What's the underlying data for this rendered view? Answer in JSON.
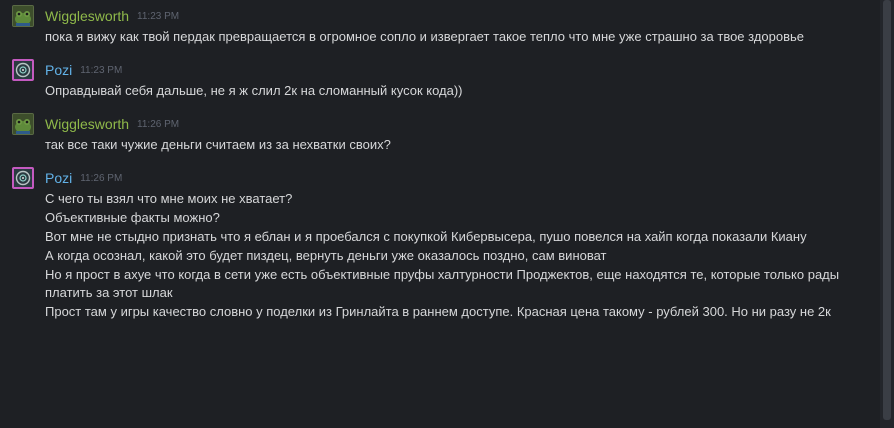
{
  "messages": [
    {
      "author": "Wigglesworth",
      "time": "11:23 PM",
      "avatar_icon": "frog-avatar-icon",
      "name_color": "#8fb94a",
      "lines": [
        "пока я вижу как твой пердак превращается в огромное сопло и извергает такое тепло что мне уже страшно за твое здоровье"
      ]
    },
    {
      "author": "Pozi",
      "time": "11:23 PM",
      "avatar_icon": "emblem-avatar-icon",
      "name_color": "#62b2e8",
      "lines": [
        "Оправдывай себя дальше, не я ж слил 2к на сломанный кусок кода))"
      ]
    },
    {
      "author": "Wigglesworth",
      "time": "11:26 PM",
      "avatar_icon": "frog-avatar-icon",
      "name_color": "#8fb94a",
      "lines": [
        "так все таки чужие деньги считаем из за нехватки своих?"
      ]
    },
    {
      "author": "Pozi",
      "time": "11:26 PM",
      "avatar_icon": "emblem-avatar-icon",
      "name_color": "#62b2e8",
      "lines": [
        "С чего ты взял что мне моих не хватает?",
        "Объективные факты можно?",
        "Вот мне не стыдно признать что я еблан и я проебался с покупкой Кибервысера, пушо повелся на хайп когда показали Киану",
        "А когда осознал, какой это будет пиздец, вернуть деньги уже оказалось поздно, сам виноват",
        "Но я прост в ахуе что когда в сети уже есть объективные пруфы халтурности Проджектов, еще находятся те, которые только рады платить за этот шлак",
        "Прост там у игры качество словно у поделки из Гринлайта в раннем доступе. Красная цена такому - рублей 300. Но ни разу не 2к"
      ]
    }
  ]
}
